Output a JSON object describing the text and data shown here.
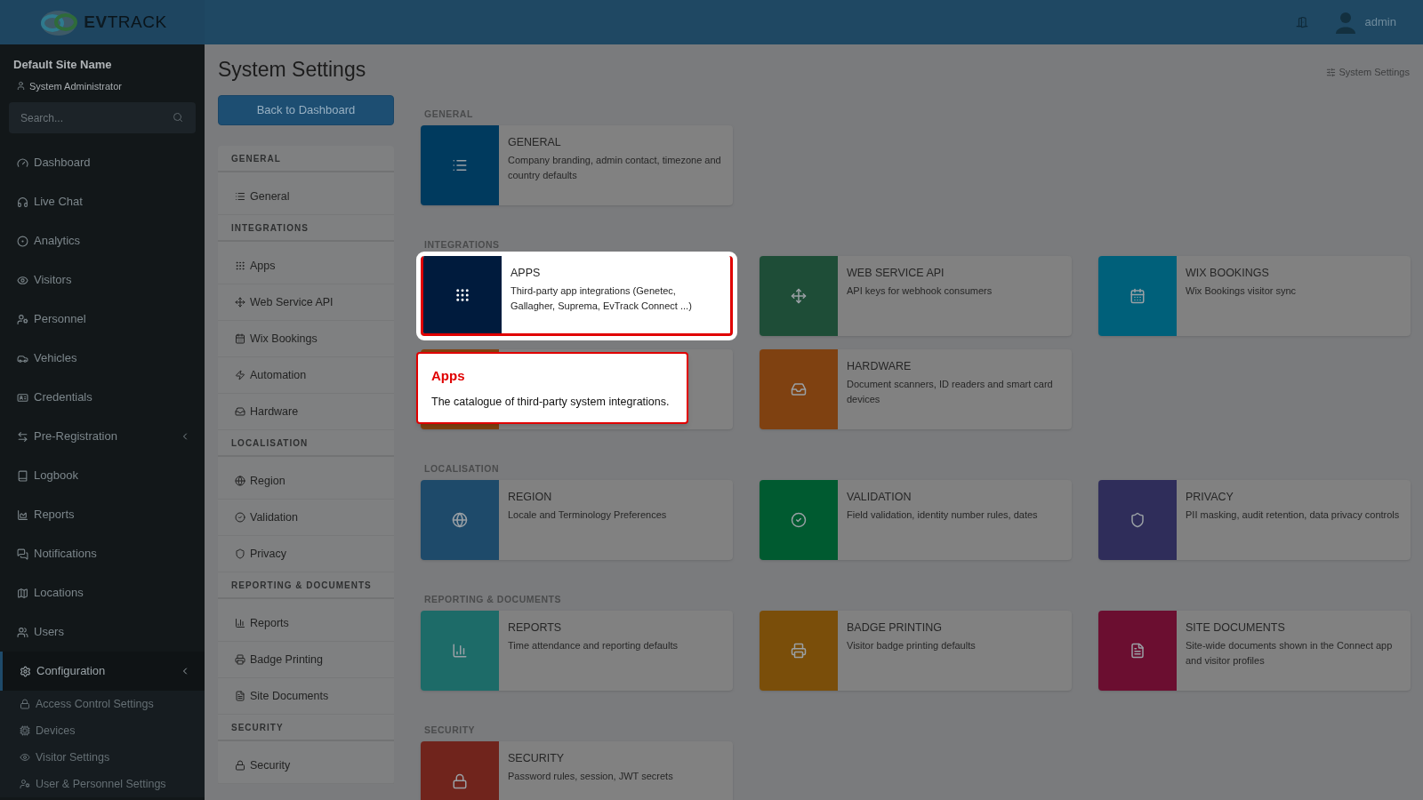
{
  "header": {
    "logo": {
      "bold": "EV",
      "light": "TRACK"
    },
    "user": "admin"
  },
  "sidebar": {
    "site_name": "Default Site Name",
    "role": "System Administrator",
    "search": {
      "placeholder": "Search..."
    },
    "items": [
      {
        "label": "Dashboard",
        "expandable": false,
        "selected": false
      },
      {
        "label": "Live Chat",
        "expandable": false,
        "selected": false
      },
      {
        "label": "Analytics",
        "expandable": false,
        "selected": false
      },
      {
        "label": "Visitors",
        "expandable": false,
        "selected": false
      },
      {
        "label": "Personnel",
        "expandable": false,
        "selected": false
      },
      {
        "label": "Vehicles",
        "expandable": false,
        "selected": false
      },
      {
        "label": "Credentials",
        "expandable": false,
        "selected": false
      },
      {
        "label": "Pre-Registration",
        "expandable": true,
        "selected": false
      },
      {
        "label": "Logbook",
        "expandable": false,
        "selected": false
      },
      {
        "label": "Reports",
        "expandable": false,
        "selected": false
      },
      {
        "label": "Notifications",
        "expandable": false,
        "selected": false
      },
      {
        "label": "Locations",
        "expandable": false,
        "selected": false
      },
      {
        "label": "Users",
        "expandable": false,
        "selected": false
      },
      {
        "label": "Configuration",
        "expandable": true,
        "selected": true,
        "children": [
          {
            "label": "Access Control Settings"
          },
          {
            "label": "Devices"
          },
          {
            "label": "Visitor Settings"
          },
          {
            "label": "User & Personnel Settings"
          }
        ]
      }
    ]
  },
  "page": {
    "title": "System Settings",
    "back_button": "Back to Dashboard",
    "breadcrumb": "System Settings"
  },
  "settings_nav": [
    {
      "heading": "GENERAL",
      "items": [
        {
          "label": "General"
        }
      ]
    },
    {
      "heading": "INTEGRATIONS",
      "items": [
        {
          "label": "Apps"
        },
        {
          "label": "Web Service API"
        },
        {
          "label": "Wix Bookings"
        },
        {
          "label": "Automation"
        },
        {
          "label": "Hardware"
        }
      ]
    },
    {
      "heading": "LOCALISATION",
      "items": [
        {
          "label": "Region"
        },
        {
          "label": "Validation"
        },
        {
          "label": "Privacy"
        }
      ]
    },
    {
      "heading": "REPORTING & DOCUMENTS",
      "items": [
        {
          "label": "Reports"
        },
        {
          "label": "Badge Printing"
        },
        {
          "label": "Site Documents"
        }
      ]
    },
    {
      "heading": "SECURITY",
      "items": [
        {
          "label": "Security"
        }
      ]
    }
  ],
  "sections": [
    {
      "heading": "GENERAL",
      "cards": [
        {
          "title": "GENERAL",
          "description": "Company branding, admin contact, timezone and country defaults",
          "color": "#003a5e",
          "highlighted": false
        }
      ]
    },
    {
      "heading": "INTEGRATIONS",
      "cards": [
        {
          "title": "APPS",
          "description": "Third-party app integrations (Genetec, Gallagher, Suprema, EvTrack Connect ...)",
          "color": "#001b3d",
          "highlighted": true
        },
        {
          "title": "WEB SERVICE API",
          "description": "API keys for webhook consumers",
          "color": "#1e4d37",
          "highlighted": false
        },
        {
          "title": "WIX BOOKINGS",
          "description": "Wix Bookings visitor sync",
          "color": "#00607a",
          "highlighted": false
        },
        {
          "color": "#7f4110",
          "highlighted": false
        },
        {
          "title": "HARDWARE",
          "description": "Document scanners, ID readers and smart card devices",
          "color": "#7f4111",
          "highlighted": false
        }
      ]
    },
    {
      "heading": "LOCALISATION",
      "cards": [
        {
          "title": "REGION",
          "description": "Locale and Terminology Preferences",
          "color": "#1e4a6a",
          "highlighted": false
        },
        {
          "title": "VALIDATION",
          "description": "Field validation, identity number rules, dates",
          "color": "#005a30",
          "highlighted": false
        },
        {
          "title": "PRIVACY",
          "description": "PII masking, audit retention, data privacy controls",
          "color": "#2f2d5a",
          "highlighted": false
        }
      ]
    },
    {
      "heading": "REPORTING & DOCUMENTS",
      "cards": [
        {
          "title": "REPORTS",
          "description": "Time attendance and reporting defaults",
          "color": "#1d6b68",
          "highlighted": false
        },
        {
          "title": "BADGE PRINTING",
          "description": "Visitor badge printing defaults",
          "color": "#7a4e0a",
          "highlighted": false
        },
        {
          "title": "SITE DOCUMENTS",
          "description": "Site-wide documents shown in the Connect app and visitor profiles",
          "color": "#6b0e30",
          "highlighted": false
        }
      ]
    },
    {
      "heading": "SECURITY",
      "cards": [
        {
          "title": "SECURITY",
          "description": "Password rules, session, JWT secrets",
          "color": "#70241c",
          "highlighted": false
        }
      ]
    }
  ],
  "tour_tip": {
    "title": "Apps",
    "text": "The catalogue of third-party system integrations."
  }
}
